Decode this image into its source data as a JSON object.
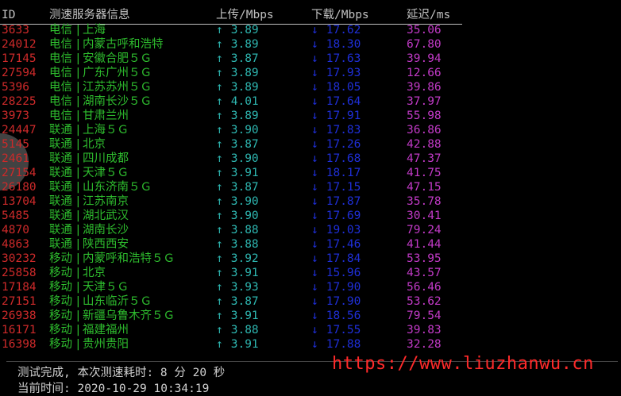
{
  "header": {
    "id": "ID",
    "name": "测速服务器信息",
    "upload": "上传/Mbps",
    "download": "下载/Mbps",
    "latency": "延迟/ms"
  },
  "rows": [
    {
      "id": "3633",
      "isp": "电信",
      "city": "上海",
      "up": "3.89",
      "down": "17.62",
      "latency": "35.06"
    },
    {
      "id": "24012",
      "isp": "电信",
      "city": "内蒙古呼和浩特",
      "up": "3.89",
      "down": "18.30",
      "latency": "67.80"
    },
    {
      "id": "17145",
      "isp": "电信",
      "city": "安徽合肥５Ｇ",
      "up": "3.87",
      "down": "17.63",
      "latency": "39.94"
    },
    {
      "id": "27594",
      "isp": "电信",
      "city": "广东广州５Ｇ",
      "up": "3.89",
      "down": "17.93",
      "latency": "12.66"
    },
    {
      "id": "5396",
      "isp": "电信",
      "city": "江苏苏州５Ｇ",
      "up": "3.89",
      "down": "18.05",
      "latency": "39.86"
    },
    {
      "id": "28225",
      "isp": "电信",
      "city": "湖南长沙５Ｇ",
      "up": "4.01",
      "down": "17.64",
      "latency": "37.97"
    },
    {
      "id": "3973",
      "isp": "电信",
      "city": "甘肃兰州",
      "up": "3.89",
      "down": "17.91",
      "latency": "55.98"
    },
    {
      "id": "24447",
      "isp": "联通",
      "city": "上海５Ｇ",
      "up": "3.90",
      "down": "17.83",
      "latency": "36.86"
    },
    {
      "id": "5145",
      "isp": "联通",
      "city": "北京",
      "up": "3.87",
      "down": "17.26",
      "latency": "42.88"
    },
    {
      "id": "2461",
      "isp": "联通",
      "city": "四川成都",
      "up": "3.90",
      "down": "17.68",
      "latency": "47.37"
    },
    {
      "id": "27154",
      "isp": "联通",
      "city": "天津５Ｇ",
      "up": "3.91",
      "down": "18.17",
      "latency": "41.75"
    },
    {
      "id": "26180",
      "isp": "联通",
      "city": "山东济南５Ｇ",
      "up": "3.87",
      "down": "17.15",
      "latency": "47.15"
    },
    {
      "id": "13704",
      "isp": "联通",
      "city": "江苏南京",
      "up": "3.90",
      "down": "17.87",
      "latency": "35.78"
    },
    {
      "id": "5485",
      "isp": "联通",
      "city": "湖北武汉",
      "up": "3.90",
      "down": "17.69",
      "latency": "30.41"
    },
    {
      "id": "4870",
      "isp": "联通",
      "city": "湖南长沙",
      "up": "3.88",
      "down": "19.03",
      "latency": "79.24"
    },
    {
      "id": "4863",
      "isp": "联通",
      "city": "陕西西安",
      "up": "3.88",
      "down": "17.46",
      "latency": "41.44"
    },
    {
      "id": "30232",
      "isp": "移动",
      "city": "内蒙呼和浩特５Ｇ",
      "up": "3.92",
      "down": "17.84",
      "latency": "53.95"
    },
    {
      "id": "25858",
      "isp": "移动",
      "city": "北京",
      "up": "3.91",
      "down": "15.96",
      "latency": "43.57"
    },
    {
      "id": "17184",
      "isp": "移动",
      "city": "天津５Ｇ",
      "up": "3.93",
      "down": "17.90",
      "latency": "56.46"
    },
    {
      "id": "27151",
      "isp": "移动",
      "city": "山东临沂５Ｇ",
      "up": "3.87",
      "down": "17.90",
      "latency": "53.62"
    },
    {
      "id": "26938",
      "isp": "移动",
      "city": "新疆乌鲁木齐５Ｇ",
      "up": "3.91",
      "down": "18.56",
      "latency": "79.54"
    },
    {
      "id": "16171",
      "isp": "移动",
      "city": "福建福州",
      "up": "3.88",
      "down": "17.55",
      "latency": "39.83"
    },
    {
      "id": "16398",
      "isp": "移动",
      "city": "贵州贵阳",
      "up": "3.91",
      "down": "17.88",
      "latency": "32.28"
    }
  ],
  "separator": "|",
  "up_arrow": "↑",
  "down_arrow": "↓",
  "footer": {
    "done": "测试完成, 本次测速耗时: 8 分 20 秒",
    "time": "当前时间: 2020-10-29 10:34:19"
  },
  "watermark": "https://www.liuzhanwu.cn",
  "colors": {
    "id": "#cd2a2a",
    "server": "#2ebd2e",
    "upload": "#2eb6b0",
    "download": "#1f2fd8",
    "latency": "#c23ac7",
    "watermark": "#ff2a2a",
    "background": "#000000"
  }
}
